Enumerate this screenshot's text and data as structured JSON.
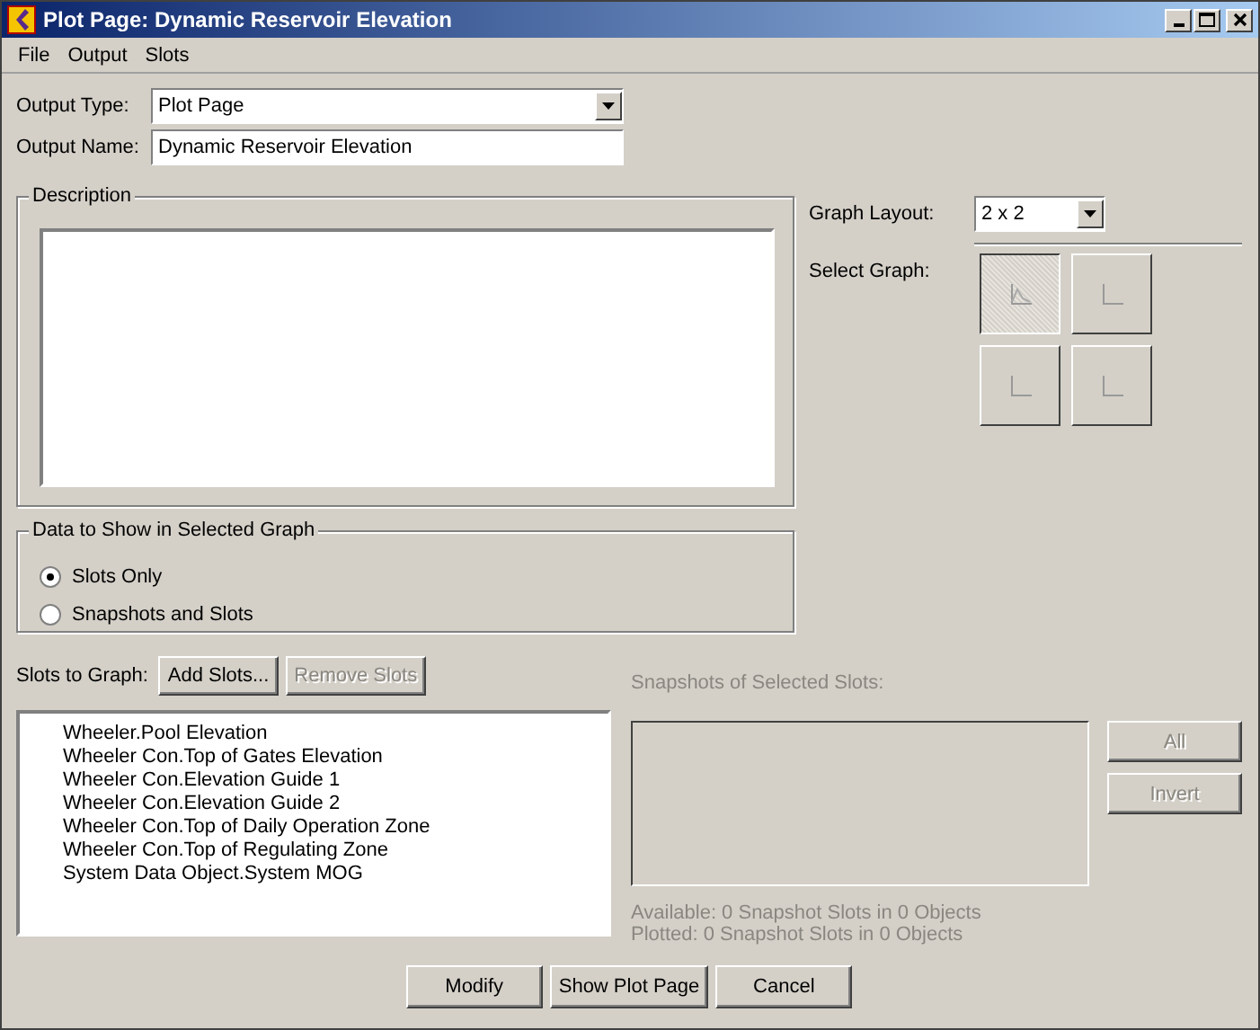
{
  "window": {
    "title": "Plot Page: Dynamic Reservoir Elevation"
  },
  "menu": [
    "File",
    "Output",
    "Slots"
  ],
  "output_type": {
    "label": "Output Type:",
    "value": "Plot Page"
  },
  "output_name": {
    "label": "Output Name:",
    "value": "Dynamic Reservoir Elevation"
  },
  "description": {
    "label": "Description"
  },
  "graph_layout": {
    "label": "Graph Layout:",
    "value": "2 x 2"
  },
  "select_graph": {
    "label": "Select Graph:",
    "graphs": [
      {
        "selected": true
      },
      {
        "selected": false
      },
      {
        "selected": false
      },
      {
        "selected": false
      }
    ]
  },
  "data_to_show": {
    "label": "Data to Show in Selected Graph",
    "options": [
      {
        "label": "Slots Only",
        "selected": true
      },
      {
        "label": "Snapshots and Slots",
        "selected": false
      }
    ]
  },
  "slots": {
    "label": "Slots to Graph:",
    "buttons": [
      {
        "label": "Add Slots...",
        "disabled": false
      },
      {
        "label": "Remove Slots",
        "disabled": true
      }
    ],
    "items": [
      "Wheeler.Pool Elevation",
      "Wheeler Con.Top of Gates Elevation",
      "Wheeler Con.Elevation Guide 1",
      "Wheeler Con.Elevation Guide 2",
      "Wheeler Con.Top of Daily Operation Zone",
      "Wheeler Con.Top of Regulating Zone",
      "System Data Object.System MOG"
    ]
  },
  "snapshots": {
    "label": "Snapshots of Selected Slots:",
    "disabled": true,
    "buttons": [
      {
        "label": "All",
        "disabled": true
      },
      {
        "label": "Invert",
        "disabled": true
      }
    ],
    "available": "Available:  0 Snapshot Slots in 0 Objects",
    "plotted": "Plotted:  0 Snapshot Slots in 0 Objects"
  },
  "buttons": [
    "Modify",
    "Show Plot Page",
    "Cancel"
  ]
}
